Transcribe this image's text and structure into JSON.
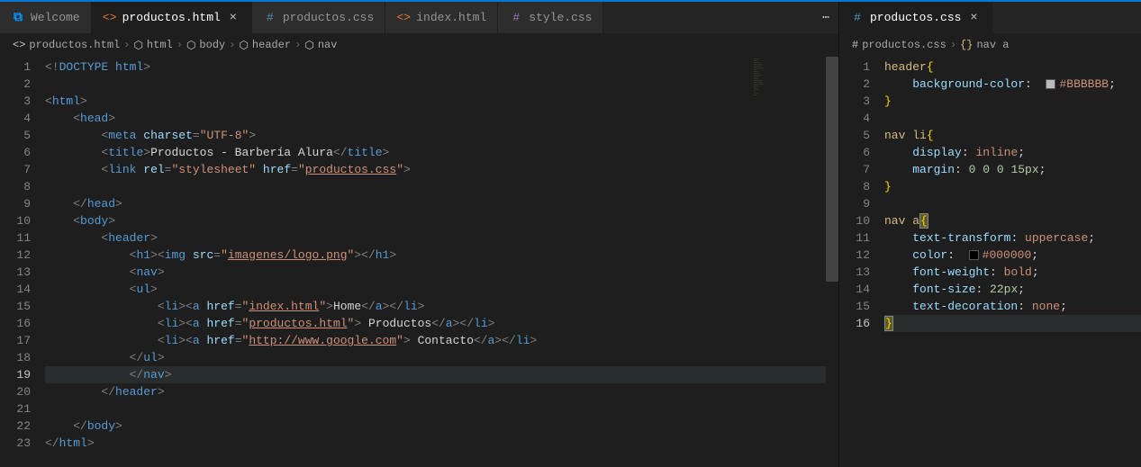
{
  "left": {
    "tabs": [
      {
        "label": "Welcome",
        "type": "vs"
      },
      {
        "label": "productos.html",
        "type": "html",
        "active": true,
        "close": true
      },
      {
        "label": "productos.css",
        "type": "css"
      },
      {
        "label": "index.html",
        "type": "html"
      },
      {
        "label": "style.css",
        "type": "cssalt"
      }
    ],
    "breadcrumb": [
      "productos.html",
      "html",
      "body",
      "header",
      "nav"
    ],
    "breadcrumbIcons": [
      "html",
      "cube",
      "cube",
      "cube",
      "cube"
    ],
    "lines": 23,
    "currentLine": 19
  },
  "right": {
    "tabs": [
      {
        "label": "productos.css",
        "type": "css",
        "active": true,
        "close": true
      }
    ],
    "breadcrumb": [
      "productos.css",
      "nav a"
    ],
    "breadcrumbIcons": [
      "css",
      "brackets"
    ],
    "lines": 16,
    "currentLine": 16
  },
  "htmlSrc": {
    "doctype": "DOCTYPE",
    "htmlWord": "html",
    "head": "head",
    "meta": "meta",
    "charset": "charset",
    "utf8": "\"UTF-8\"",
    "title": "title",
    "titleText": "Productos - Barbería Alura",
    "link": "link",
    "rel": "rel",
    "stylesheet": "\"stylesheet\"",
    "href": "href",
    "cssHref": "productos.css",
    "body": "body",
    "header": "header",
    "h1": "h1",
    "img": "img",
    "src": "src",
    "logo": "imagenes/logo.png",
    "nav": "nav",
    "ul": "ul",
    "li": "li",
    "a": "a",
    "indexHref": "index.html",
    "homeText": "Home",
    "productosHref": "productos.html",
    "productosText": " Productos",
    "googleHref": "http://www.google.com",
    "contactoText": " Contacto"
  },
  "cssSrc": {
    "sel1": "header",
    "p1": "background-color",
    "v1": "#BBBBBB",
    "sel2": "nav li",
    "p2a": "display",
    "v2a": "inline",
    "p2b": "margin",
    "v2b": "0 0 0 15px",
    "sel3": "nav a",
    "p3a": "text-transform",
    "v3a": "uppercase",
    "p3b": "color",
    "v3b": "#000000",
    "p3c": "font-weight",
    "v3c": "bold",
    "p3d": "font-size",
    "v3d": "22px",
    "p3e": "text-decoration",
    "v3e": "none"
  },
  "ellipsis": "⋯"
}
